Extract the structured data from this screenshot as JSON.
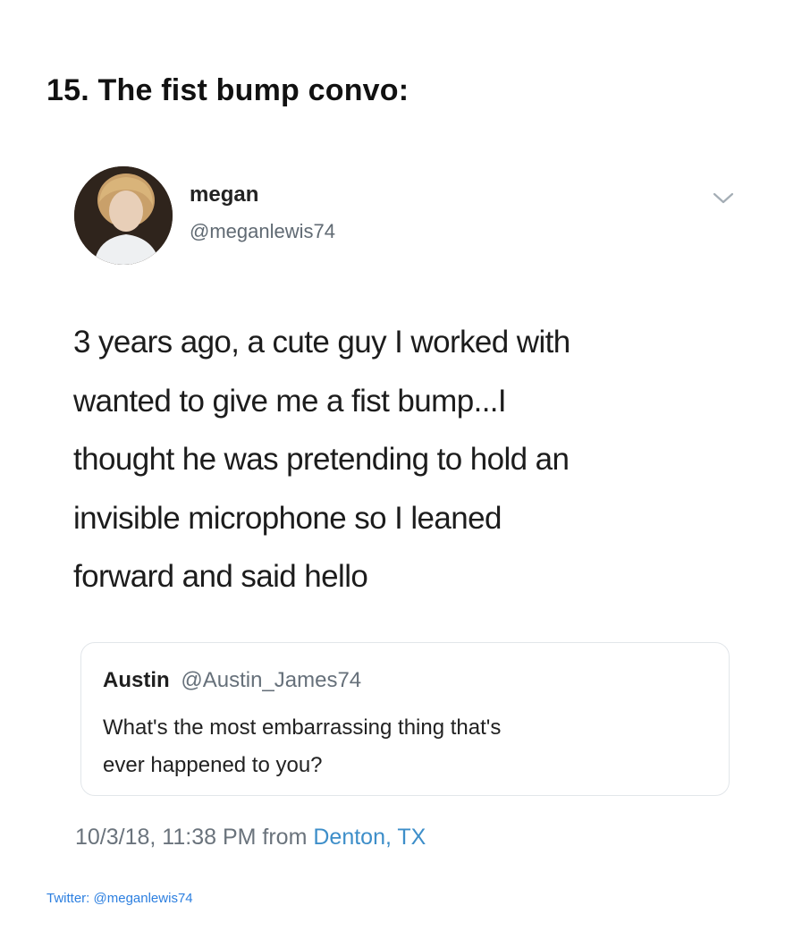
{
  "heading": "15. The fist bump convo:",
  "tweet": {
    "avatar_icon": "profile-photo",
    "display_name": "megan",
    "handle": "@meganlewis74",
    "menu_icon": "chevron-down-icon",
    "text_lines": [
      "3 years ago, a cute guy I worked with",
      "wanted to give me a fist bump...I",
      "thought he was pretending to hold an",
      "invisible microphone so I leaned",
      "forward and said hello"
    ],
    "quoted": {
      "name": "Austin",
      "handle": "@Austin_James74",
      "text_lines": [
        "What's the most embarrassing thing that's",
        "ever happened to you?"
      ]
    },
    "timestamp": "10/3/18, 11:38 PM from",
    "location": "Denton, TX"
  },
  "credit": "Twitter: @meganlewis74",
  "colors": {
    "link": "#3d8ec9",
    "muted": "#6a737c",
    "credit": "#2c7fe0"
  }
}
